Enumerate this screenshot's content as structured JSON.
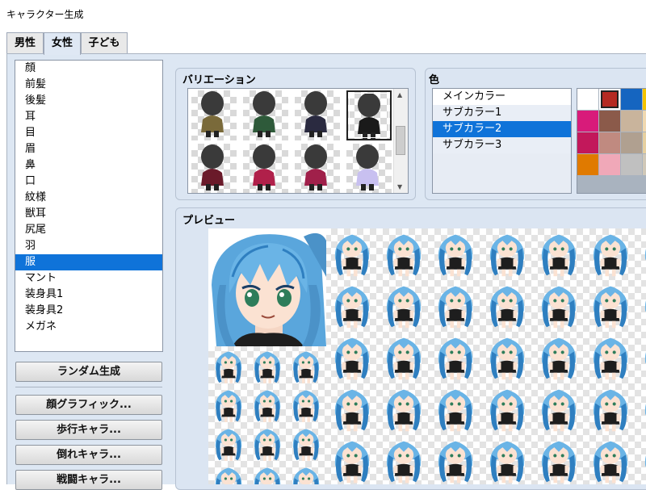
{
  "window": {
    "title": "キャラクター生成"
  },
  "tabs": [
    {
      "label": "男性",
      "active": false
    },
    {
      "label": "女性",
      "active": true
    },
    {
      "label": "子ども",
      "active": false
    }
  ],
  "parts": {
    "items": [
      "顔",
      "前髪",
      "後髪",
      "耳",
      "目",
      "眉",
      "鼻",
      "口",
      "紋様",
      "獣耳",
      "尻尾",
      "羽",
      "服",
      "マント",
      "装身具1",
      "装身具2",
      "メガネ"
    ],
    "selected": "服"
  },
  "buttons": {
    "random": "ランダム生成",
    "face": "顔グラフィック...",
    "walk": "歩行キャラ...",
    "down": "倒れキャラ...",
    "battle": "戦闘キャラ..."
  },
  "variation": {
    "title": "バリエーション",
    "selected_index": 3
  },
  "color": {
    "title": "色",
    "items": [
      "メインカラー",
      "サブカラー1",
      "サブカラー2",
      "サブカラー3"
    ],
    "selected": "サブカラー2"
  },
  "palette": {
    "swatches": [
      "#ffffff",
      "#b52a22",
      "#1565c0",
      "#f4c400",
      "#d81b7a",
      "#8b5a4a",
      "#c9b49c",
      "#f0d8b0",
      "#c2185b",
      "#c08a80",
      "#b0a090",
      "#e6d0a0",
      "#e07a00",
      "#f0a8b8",
      "#c0c0c0",
      "#d0c8b8"
    ],
    "selected_index": 1
  },
  "preview": {
    "title": "プレビュー"
  },
  "colors": {
    "accent": "#0f73d9",
    "panel": "#dde7f3",
    "hair": "#6ab4e6",
    "hair_dark": "#2f7fc0",
    "skin": "#fbe2d2",
    "outfit": "#1e1e1e"
  }
}
